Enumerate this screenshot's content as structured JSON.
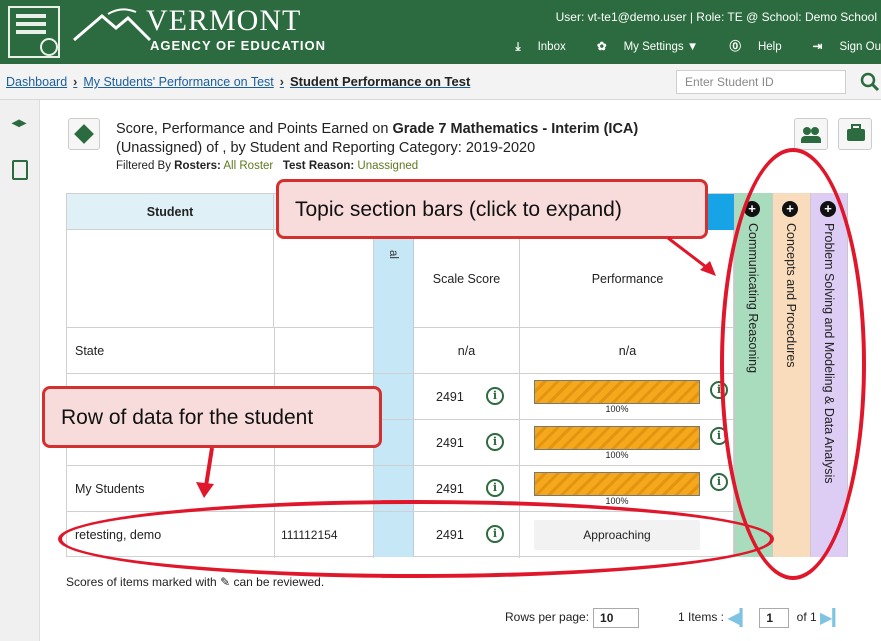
{
  "header": {
    "title": "VERMONT",
    "subtitle": "AGENCY OF EDUCATION",
    "user_line": "User: vt-te1@demo.user  |  Role: TE @ School: Demo School",
    "inbox": "Inbox",
    "settings": "My Settings ▼",
    "help": "Help",
    "signout": "Sign Ou"
  },
  "breadcrumb": {
    "items": [
      "Dashboard",
      "My Students' Performance on Test"
    ],
    "current": "Student Performance on Test",
    "student_id_placeholder": "Enter Student ID"
  },
  "report": {
    "title_prefix": "Score, Performance and Points Earned on ",
    "title_bold": "Grade 7 Mathematics - Interim (ICA)",
    "title_line2": "(Unassigned) of , by Student and Reporting Category: 2019-2020",
    "filter_label": "Filtered By",
    "rosters_label": "Rosters:",
    "rosters_value": "All Roster",
    "reason_label": "Test Reason:",
    "reason_value": "Unassigned"
  },
  "table": {
    "col_student": "Student",
    "band_label": "al",
    "col_scale": "Scale Score",
    "col_perf": "Performance",
    "rows": [
      {
        "name": "State",
        "id": "",
        "score": "n/a",
        "perf": "n/a"
      },
      {
        "name": "",
        "id": "",
        "score": "2491",
        "perf_pct": "100%"
      },
      {
        "name": "",
        "id": "",
        "score": "2491",
        "perf_pct": "100%"
      },
      {
        "name": "My Students",
        "id": "",
        "score": "2491",
        "perf_pct": "100%"
      },
      {
        "name": "retesting, demo",
        "id": "111112154",
        "score": "2491",
        "perf": "Approaching"
      }
    ]
  },
  "topics": [
    {
      "label": "Communicating Reasoning",
      "color": "#a8dcbc"
    },
    {
      "label": "Concepts and Procedures",
      "color": "#f9dcbc"
    },
    {
      "label": "Problem Solving and Modeling & Data Analysis",
      "color": "#ddcdf5"
    }
  ],
  "footer": {
    "note_prefix": "Scores of items marked with",
    "note_suffix": "can be reviewed.",
    "rows_per_page_label": "Rows per page:",
    "rows_per_page": "10",
    "items_label": "1 Items :",
    "page": "1",
    "of_label": "of 1"
  },
  "callouts": {
    "topic": "Topic section bars (click to expand)",
    "row": "Row of data for the student"
  },
  "colors": {
    "header_green": "#2c6b3f",
    "callout_red": "#d43030"
  }
}
